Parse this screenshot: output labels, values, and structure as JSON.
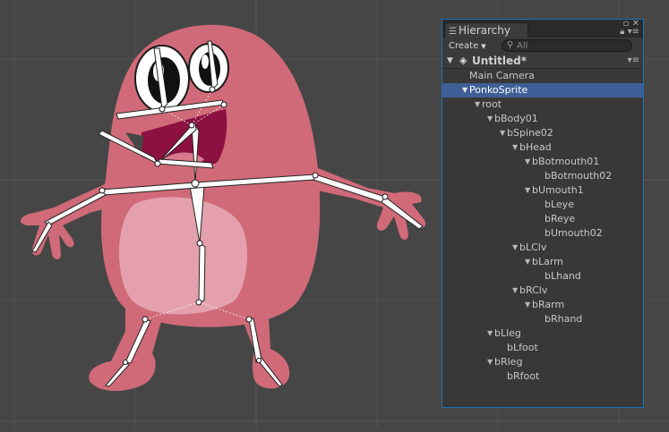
{
  "hierarchy": {
    "tab_title": "Hierarchy",
    "create_label": "Create",
    "search_placeholder": "All",
    "scene_title": "Untitled*",
    "items": [
      {
        "label": "Main Camera",
        "depth": 0,
        "expanded": null,
        "selected": false
      },
      {
        "label": "PonkoSprite",
        "depth": 0,
        "expanded": true,
        "selected": true
      },
      {
        "label": "root",
        "depth": 1,
        "expanded": true,
        "selected": false
      },
      {
        "label": "bBody01",
        "depth": 2,
        "expanded": true,
        "selected": false
      },
      {
        "label": "bSpine02",
        "depth": 3,
        "expanded": true,
        "selected": false
      },
      {
        "label": "bHead",
        "depth": 4,
        "expanded": true,
        "selected": false
      },
      {
        "label": "bBotmouth01",
        "depth": 5,
        "expanded": true,
        "selected": false
      },
      {
        "label": "bBotmouth02",
        "depth": 6,
        "expanded": null,
        "selected": false
      },
      {
        "label": "bUmouth1",
        "depth": 5,
        "expanded": true,
        "selected": false
      },
      {
        "label": "bLeye",
        "depth": 6,
        "expanded": null,
        "selected": false
      },
      {
        "label": "bReye",
        "depth": 6,
        "expanded": null,
        "selected": false
      },
      {
        "label": "bUmouth02",
        "depth": 6,
        "expanded": null,
        "selected": false
      },
      {
        "label": "bLClv",
        "depth": 4,
        "expanded": true,
        "selected": false
      },
      {
        "label": "bLarm",
        "depth": 5,
        "expanded": true,
        "selected": false
      },
      {
        "label": "bLhand",
        "depth": 6,
        "expanded": null,
        "selected": false
      },
      {
        "label": "bRClv",
        "depth": 4,
        "expanded": true,
        "selected": false
      },
      {
        "label": "bRarm",
        "depth": 5,
        "expanded": true,
        "selected": false
      },
      {
        "label": "bRhand",
        "depth": 6,
        "expanded": null,
        "selected": false
      },
      {
        "label": "bLleg",
        "depth": 2,
        "expanded": true,
        "selected": false
      },
      {
        "label": "bLfoot",
        "depth": 3,
        "expanded": null,
        "selected": false
      },
      {
        "label": "bRleg",
        "depth": 2,
        "expanded": true,
        "selected": false
      },
      {
        "label": "bRfoot",
        "depth": 3,
        "expanded": null,
        "selected": false
      }
    ]
  },
  "colors": {
    "scene_bg": "#464646",
    "grid_line": "#525252",
    "axis_line": "#5a5a5a",
    "body_pink": "#d06a78",
    "belly": "#e4a1ad",
    "mouth": "#8c1040",
    "tongue": "#d9788f",
    "panel_bg": "#383838",
    "selection": "#3e5f96"
  },
  "icons": {
    "hierarchy_tab": "list-icon",
    "search": "magnifier-icon",
    "scene": "unity-logo-icon",
    "close": "close-icon",
    "lock": "lock-icon",
    "menu": "context-menu-icon"
  }
}
